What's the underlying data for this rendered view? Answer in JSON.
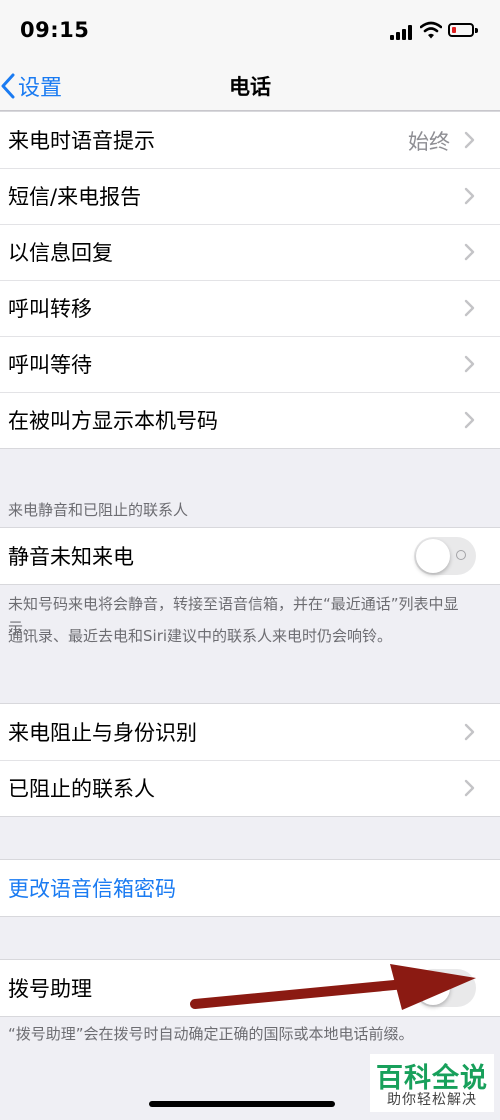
{
  "status_bar": {
    "time": "09:15",
    "icons": [
      "signal-icon",
      "wifi-icon",
      "battery-low-icon"
    ],
    "battery_color": "#e02020"
  },
  "nav": {
    "back_label": "设置",
    "title": "电话",
    "accent": "#1a7bf2"
  },
  "group1": {
    "rows": [
      {
        "label": "来电时语音提示",
        "value": "始终"
      },
      {
        "label": "短信/来电报告"
      },
      {
        "label": "以信息回复"
      },
      {
        "label": "呼叫转移"
      },
      {
        "label": "呼叫等待"
      },
      {
        "label": "在被叫方显示本机号码"
      }
    ]
  },
  "silence": {
    "header": "来电静音和已阻止的联系人",
    "label": "静音未知来电",
    "enabled": false,
    "footer1": "未知号码来电将会静音，转接至语音信箱，并在“最近通话”列表中显示。",
    "footer2": "通讯录、最近去电和Siri建议中的联系人来电时仍会响铃。"
  },
  "blocking": {
    "rows": [
      {
        "label": "来电阻止与身份识别"
      },
      {
        "label": "已阻止的联系人"
      }
    ]
  },
  "voicemail": {
    "label": "更改语音信箱密码"
  },
  "dial_assist": {
    "label": "拨号助理",
    "enabled": false,
    "footer": "“拨号助理”会在拨号时自动确定正确的国际或本地电话前缀。"
  },
  "annotation": {
    "arrow_color": "#8b1a12"
  },
  "watermark": {
    "title": "百科全说",
    "subtitle": "助你轻松解决",
    "color": "#18a05b"
  }
}
